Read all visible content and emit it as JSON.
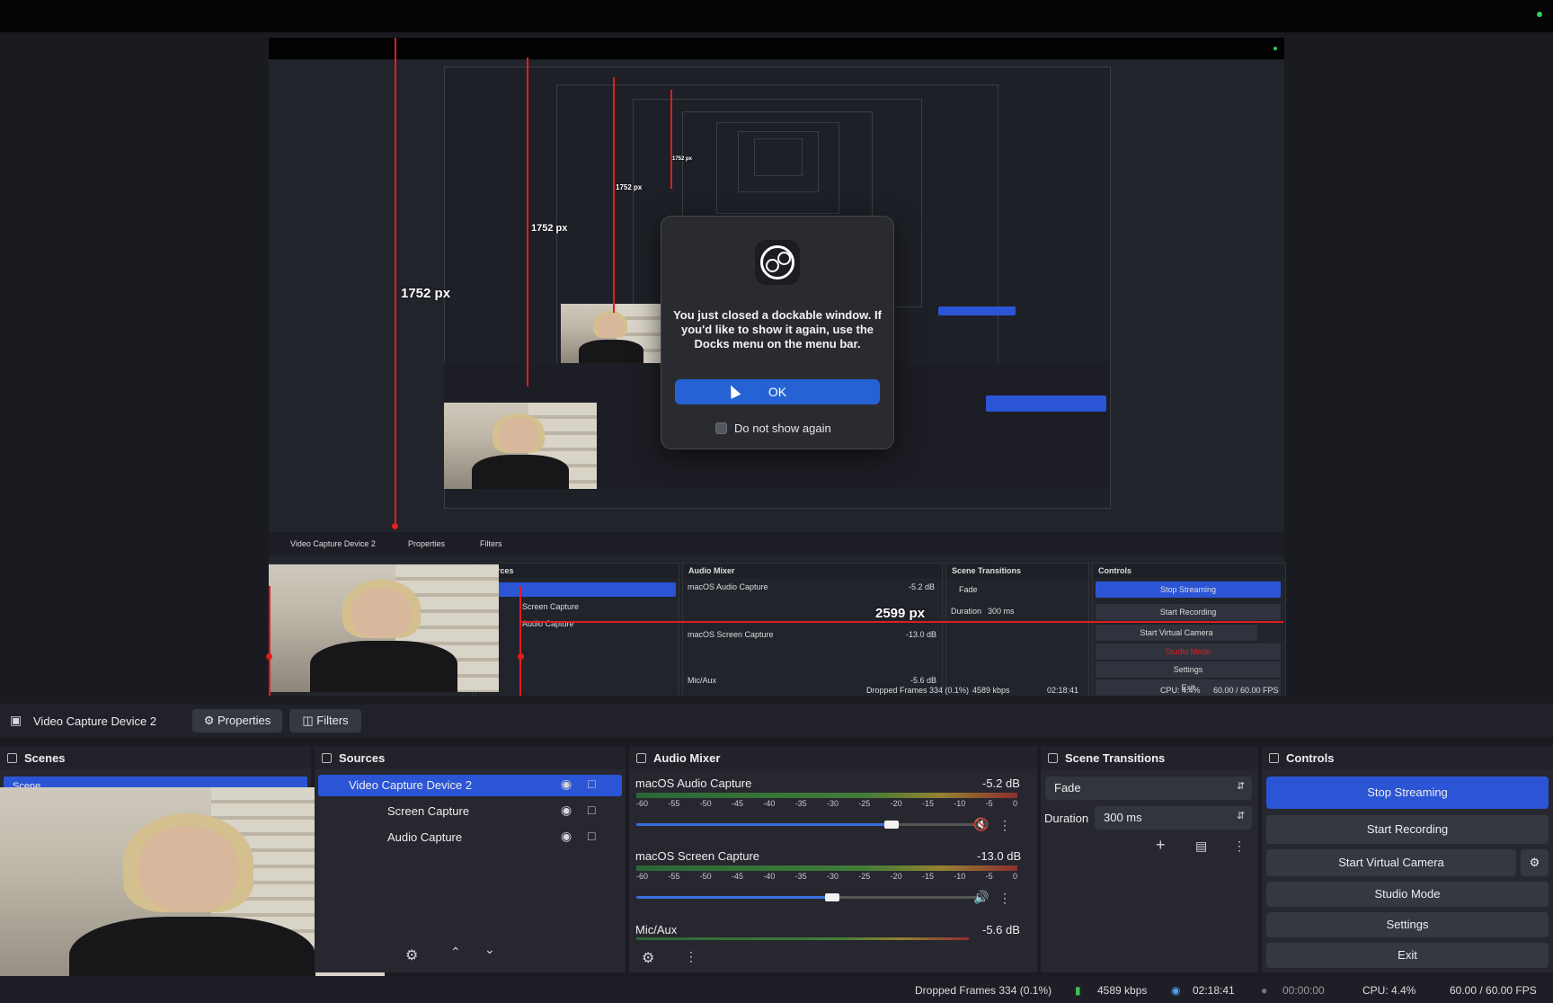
{
  "measurements": {
    "height_1": "1752 px",
    "height_2": "1752 px",
    "height_3": "1752 px",
    "height_4": "1752 px",
    "width_1": "2599 px"
  },
  "dialog": {
    "message": "You just closed a dockable window. If you'd like to show it again, use the Docks menu on the menu bar.",
    "ok_label": "OK",
    "checkbox_label": "Do not show again"
  },
  "source_bar": {
    "source_name": "Video Capture Device 2",
    "properties_label": "Properties",
    "filters_label": "Filters"
  },
  "scenes": {
    "title": "Scenes",
    "items": [
      "Scene"
    ]
  },
  "sources": {
    "title": "Sources",
    "items": [
      "Video Capture Device 2",
      "Screen Capture",
      "Audio Capture"
    ]
  },
  "audio_mixer": {
    "title": "Audio Mixer",
    "scale": [
      "-60",
      "-55",
      "-50",
      "-45",
      "-40",
      "-35",
      "-30",
      "-25",
      "-20",
      "-15",
      "-10",
      "-5",
      "0"
    ],
    "channels": [
      {
        "name": "macOS Audio Capture",
        "db": "-5.2 dB",
        "level": 0.82
      },
      {
        "name": "macOS Screen Capture",
        "db": "-13.0 dB",
        "level": 0.62
      },
      {
        "name": "Mic/Aux",
        "db": "-5.6 dB",
        "level": 0.82
      }
    ]
  },
  "scene_transitions": {
    "title": "Scene Transitions",
    "transition": "Fade",
    "duration_label": "Duration",
    "duration_value": "300 ms"
  },
  "controls": {
    "title": "Controls",
    "stop_streaming": "Stop Streaming",
    "start_recording": "Start Recording",
    "start_virtual_camera": "Start Virtual Camera",
    "studio_mode": "Studio Mode",
    "settings": "Settings",
    "exit": "Exit"
  },
  "status": {
    "dropped_frames": "Dropped Frames 334 (0.1%)",
    "bitrate": "4589 kbps",
    "stream_time": "02:18:41",
    "rec_time": "00:00:00",
    "cpu": "CPU: 4.4%",
    "fps": "60.00 / 60.00 FPS"
  },
  "colors": {
    "accent": "#2c55d6",
    "measure_line": "#e11d1d",
    "dialog_button": "#2563d4"
  }
}
